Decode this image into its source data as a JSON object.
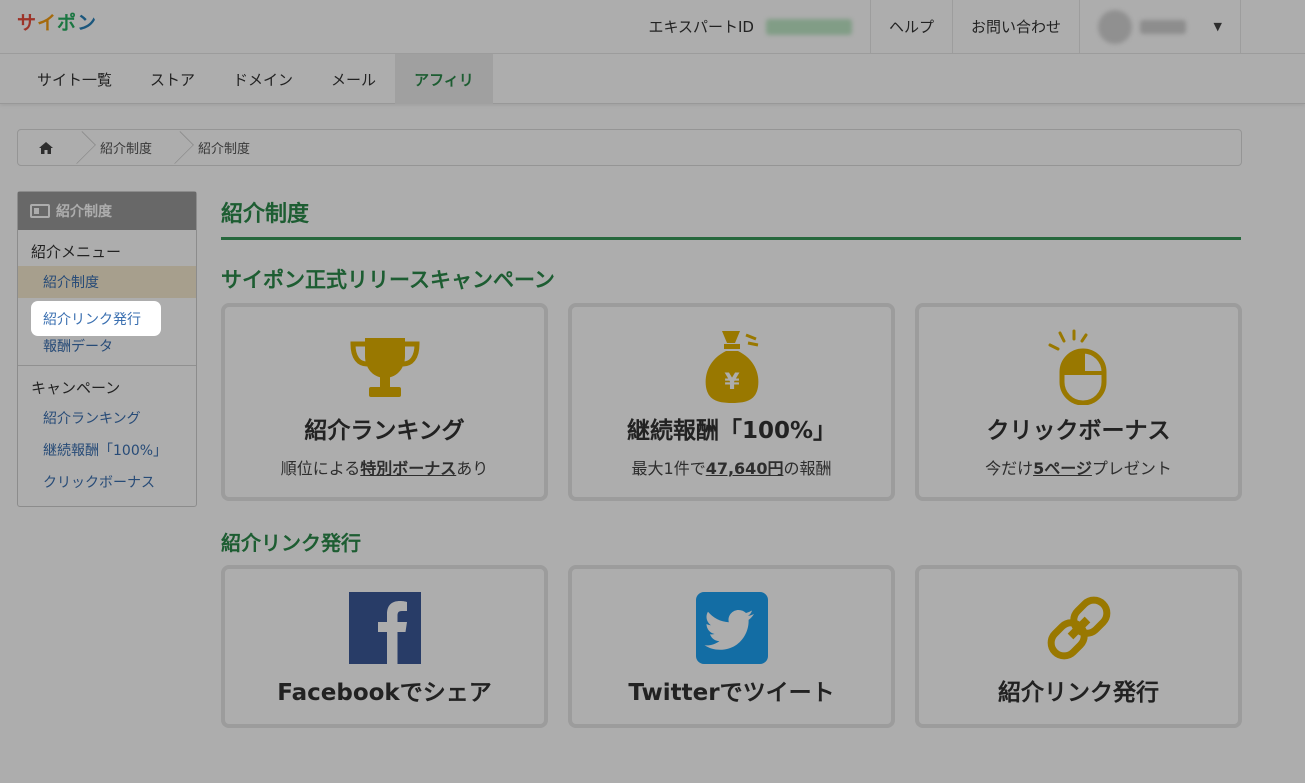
{
  "header": {
    "logo_chars": [
      "サ",
      "イ",
      "ポ",
      "ン"
    ],
    "logo_colors": [
      "#e74c3c",
      "#f39c12",
      "#27ae60",
      "#2980b9"
    ],
    "expert_id_label": "エキスパートID",
    "help_label": "ヘルプ",
    "contact_label": "お問い合わせ"
  },
  "mainnav": {
    "tabs": [
      {
        "label": "サイト一覧"
      },
      {
        "label": "ストア"
      },
      {
        "label": "ドメイン"
      },
      {
        "label": "メール"
      },
      {
        "label": "アフィリ"
      }
    ],
    "active_tab": "アフィリ"
  },
  "breadcrumb": {
    "home_icon": "home-icon",
    "items": [
      "紹介制度",
      "紹介制度"
    ]
  },
  "sidebar": {
    "heading": "紹介制度",
    "sections": [
      {
        "title": "紹介メニュー",
        "links": [
          "紹介制度",
          "紹介リンク発行",
          "報酬データ"
        ]
      },
      {
        "title": "キャンペーン",
        "links": [
          "紹介ランキング",
          "継続報酬「100%」",
          "クリックボーナス"
        ]
      }
    ]
  },
  "main": {
    "page_title": "紹介制度",
    "campaign_title": "サイポン正式リリースキャンペーン",
    "campaign_cards": [
      {
        "icon": "trophy-icon",
        "title": "紹介ランキング",
        "pre": "順位による",
        "bold": "特別ボーナス",
        "post": "あり"
      },
      {
        "icon": "money-bag-icon",
        "title": "継続報酬「100%」",
        "pre": "最大1件で",
        "bold": "47,640円",
        "post": "の報酬"
      },
      {
        "icon": "mouse-click-icon",
        "title": "クリックボーナス",
        "pre": "今だけ",
        "bold": "5ページ",
        "post": "プレゼント"
      }
    ],
    "link_title": "紹介リンク発行",
    "link_cards": [
      {
        "icon": "facebook-icon",
        "title": "Facebookでシェア"
      },
      {
        "icon": "twitter-icon",
        "title": "Twitterでツイート"
      },
      {
        "icon": "link-icon",
        "title": "紹介リンク発行"
      }
    ]
  },
  "colors": {
    "accent_green": "#2c8a4a",
    "gold": "#e2b100",
    "facebook": "#3b5998",
    "twitter": "#1da1f2"
  }
}
